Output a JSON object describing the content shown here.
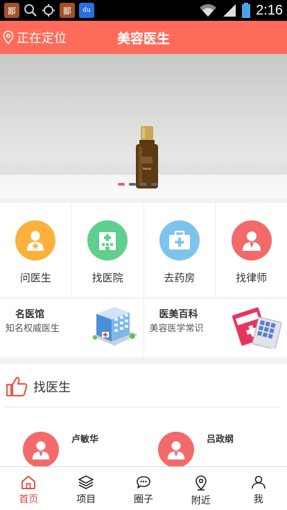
{
  "status_bar": {
    "time": "2:16",
    "apps": [
      {
        "icon": "app-icon-1",
        "glyph": "鄙"
      },
      {
        "icon": "search-icon"
      },
      {
        "icon": "target-icon"
      },
      {
        "icon": "app-icon-2",
        "glyph": "鄙"
      },
      {
        "icon": "baidu-icon",
        "glyph": "du"
      }
    ]
  },
  "header": {
    "location_label": "正在定位",
    "title": "美容医生",
    "accent_color": "#ff6b5a"
  },
  "banner": {
    "slide_count": 4,
    "active_slide": 1
  },
  "shortcuts": [
    {
      "label": "问医生",
      "icon": "doctor-icon",
      "color": "#fbb13c"
    },
    {
      "label": "找医院",
      "icon": "hospital-icon",
      "color": "#5ed08b"
    },
    {
      "label": "去药房",
      "icon": "medkit-icon",
      "color": "#7cc4ec"
    },
    {
      "label": "找律师",
      "icon": "lawyer-icon",
      "color": "#f26a6a"
    }
  ],
  "feature_cards": [
    {
      "title": "名医馆",
      "subtitle": "知名权威医生",
      "icon": "hospital-building-illustration"
    },
    {
      "title": "医美百科",
      "subtitle": "美容医学常识",
      "icon": "medical-cards-illustration"
    }
  ],
  "find_doctor": {
    "title": "找医生",
    "icon": "thumbs-up-icon",
    "doctors": [
      {
        "name": "卢敏华"
      },
      {
        "name": "吕政纲"
      }
    ]
  },
  "tabs": [
    {
      "label": "首页",
      "icon": "home-icon",
      "active": true
    },
    {
      "label": "项目",
      "icon": "layers-icon",
      "active": false
    },
    {
      "label": "圈子",
      "icon": "chat-icon",
      "active": false
    },
    {
      "label": "附近",
      "icon": "location-icon",
      "active": false
    },
    {
      "label": "我",
      "icon": "user-icon",
      "active": false
    }
  ]
}
